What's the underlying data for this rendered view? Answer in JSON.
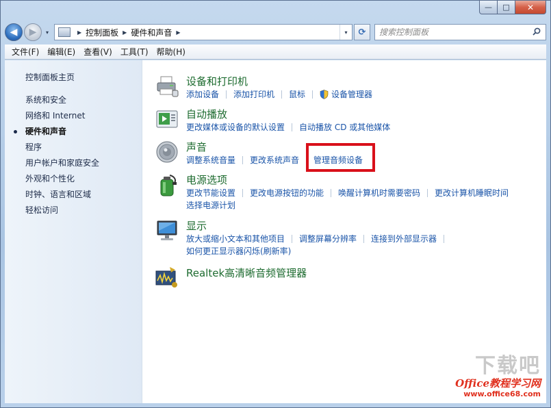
{
  "window": {
    "controls": {
      "minimize": "—",
      "maximize": "□",
      "close": "✕"
    }
  },
  "navigation": {
    "back_icon": "◀",
    "forward_icon": "▶",
    "dropdown_icon": "▾",
    "breadcrumbs": [
      "控制面板",
      "硬件和声音"
    ],
    "refresh_icon": "⟳",
    "search_placeholder": "搜索控制面板"
  },
  "menu": [
    "文件(F)",
    "编辑(E)",
    "查看(V)",
    "工具(T)",
    "帮助(H)"
  ],
  "sidebar": {
    "home": "控制面板主页",
    "items": [
      "系统和安全",
      "网络和 Internet",
      "硬件和声音",
      "程序",
      "用户帐户和家庭安全",
      "外观和个性化",
      "时钟、语言和区域",
      "轻松访问"
    ],
    "active_index": 2
  },
  "categories": [
    {
      "icon": "printer-icon",
      "title": "设备和打印机",
      "links": [
        "添加设备",
        "添加打印机",
        "鼠标",
        "设备管理器"
      ]
    },
    {
      "icon": "autoplay-icon",
      "title": "自动播放",
      "links": [
        "更改媒体或设备的默认设置",
        "自动播放 CD 或其他媒体"
      ]
    },
    {
      "icon": "speaker-icon",
      "title": "声音",
      "links": [
        "调整系统音量",
        "更改系统声音",
        "管理音频设备"
      ]
    },
    {
      "icon": "battery-icon",
      "title": "电源选项",
      "links": [
        "更改节能设置",
        "更改电源按钮的功能",
        "唤醒计算机时需要密码",
        "更改计算机睡眠时间",
        "选择电源计划"
      ]
    },
    {
      "icon": "monitor-icon",
      "title": "显示",
      "links": [
        "放大或缩小文本和其他项目",
        "调整屏幕分辨率",
        "连接到外部显示器",
        "如何更正显示器闪烁(刷新率)"
      ]
    },
    {
      "icon": "realtek-icon",
      "title": "Realtek高清晰音频管理器",
      "links": []
    }
  ],
  "colors": {
    "highlight": "#d9101a",
    "link": "#1a54a8",
    "title": "#1d6b2f"
  },
  "watermark": {
    "big": "下载吧",
    "line1": "Office教程学习网",
    "line2": "www.office68.com"
  }
}
